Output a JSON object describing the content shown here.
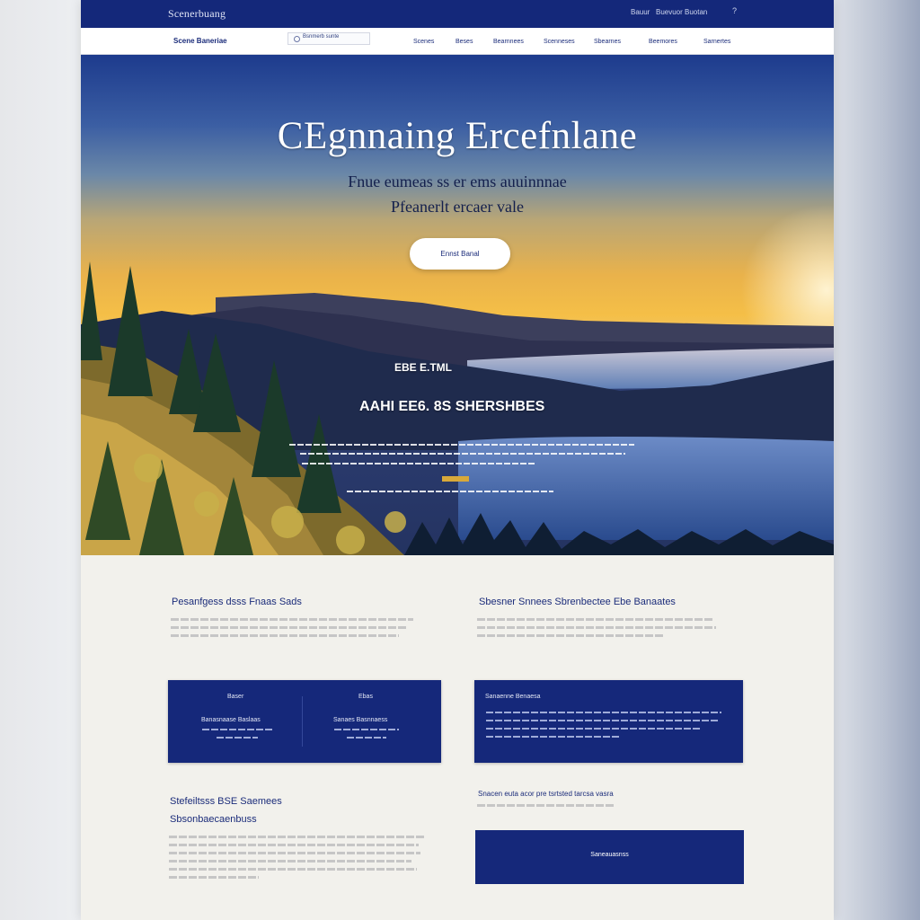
{
  "topbar": {
    "brand": "Scenerbuang",
    "util_1": "Bauur",
    "util_2": "Buevuor   Buotan",
    "util_3": "?"
  },
  "navbar": {
    "logo": "Scene Baneriae",
    "search_value": "Bsnmerb sunte",
    "items": [
      "Scenes",
      "Beses",
      "Bearnnees",
      "Scenneses",
      "Sbearnes",
      "Beemores",
      "Sarnertes"
    ]
  },
  "hero": {
    "title": "CEgnnaing Ercefnlane",
    "subtitle_1": "Fnue eumeas  ss er ems auuinnnae",
    "subtitle_2": "Pfeanerlt ercaer vale",
    "button_label": "Ennst   Banal",
    "kicker": "EBE E.TML",
    "headline": "AAHI EE6. 8S SHERSHBES"
  },
  "section_left": {
    "title": "Pesanfgess  dsss  Fnaas  Sads",
    "card": {
      "col1_heading": "Baser",
      "col1_label": "Banasnaase Baslaas",
      "col2_heading": "Ebas",
      "col2_label": "Sanaes Basnnaess"
    }
  },
  "section_right": {
    "title": "Sbesner  Snnees  Sbrenbectee  Ebe  Banaates",
    "card_label": "Sanaenne Benaesa"
  },
  "section_left_2": {
    "title_1": "Stefeiltsss  BSE  Saemees",
    "title_2": "Sbsonbaecaenbuss"
  },
  "section_right_2": {
    "subtitle": "Snacen euta  acor  pre tsrtsted tarcsa vasra",
    "cta_label": "Saneauasnss"
  },
  "colors": {
    "brand_navy": "#15287a",
    "accent_gold": "#f5bf47",
    "page_background": "#f2f1ec"
  }
}
